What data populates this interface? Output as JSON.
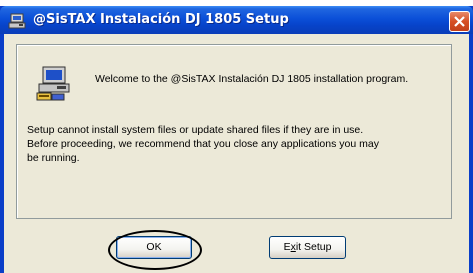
{
  "window": {
    "title": "@SisTAX Instalación DJ 1805 Setup",
    "title_icon": "setup-app-icon",
    "close_icon": "close-icon"
  },
  "dialog": {
    "welcome_text": "Welcome to the @SisTAX Instalación DJ 1805 installation program.",
    "body_line1": "Setup cannot install system files or update shared files if they are in use.",
    "body_line2": "Before proceeding, we recommend that you close any applications you may",
    "body_line3": "be running.",
    "icon": "computer-setup-icon"
  },
  "buttons": {
    "ok_label": "OK",
    "exit_prefix": "E",
    "exit_accel": "x",
    "exit_suffix": "it Setup"
  },
  "colors": {
    "titlebar": "#0a4fd8",
    "window_bg": "#ece9d8",
    "close_button": "#d64f24"
  }
}
